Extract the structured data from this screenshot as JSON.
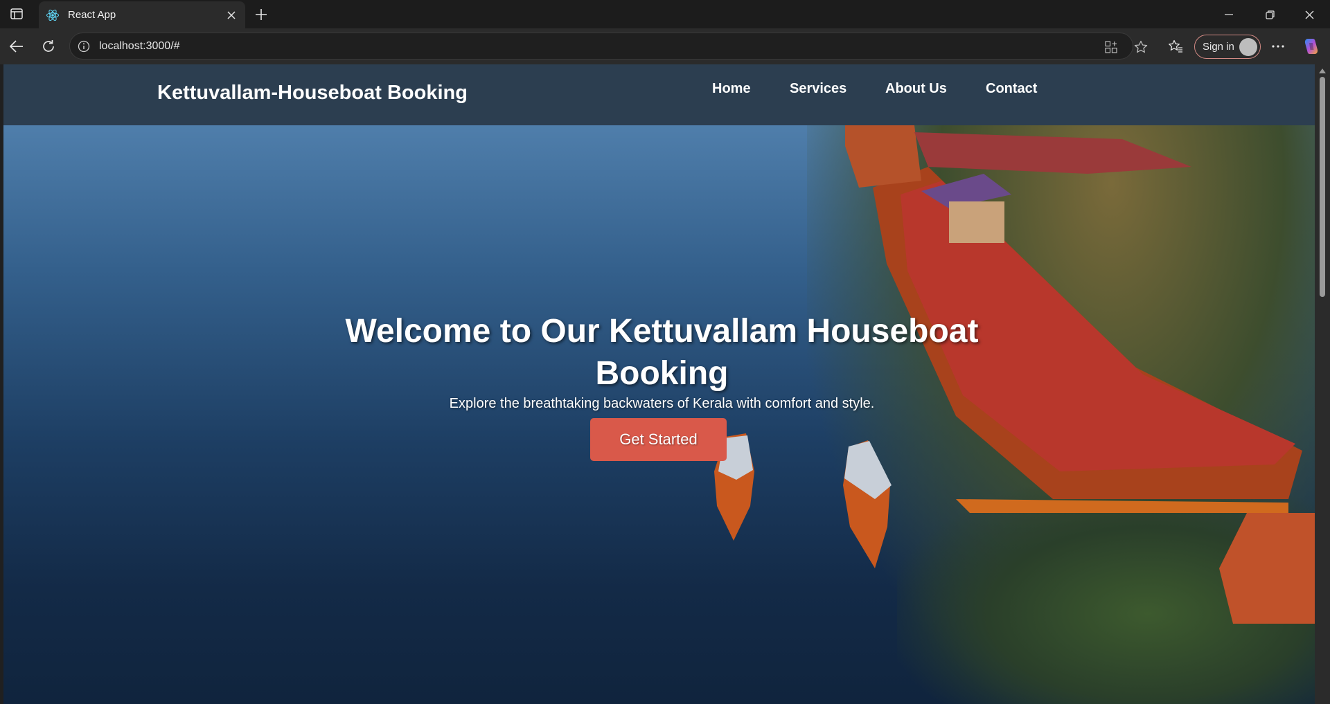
{
  "browser": {
    "tab_title": "React App",
    "url": "localhost:3000/#",
    "signin_label": "Sign in",
    "icons": [
      "sidebar-toggle-icon",
      "react-favicon-icon",
      "close-icon",
      "plus-icon",
      "minimize-icon",
      "restore-icon",
      "window-close-icon",
      "back-arrow-icon",
      "refresh-icon",
      "info-icon",
      "app-available-icon",
      "star-icon",
      "favorites-icon",
      "more-icon",
      "copilot-icon"
    ]
  },
  "site": {
    "brand": "Kettuvallam-Houseboat Booking",
    "nav": {
      "home": "Home",
      "services": "Services",
      "about": "About Us",
      "contact": "Contact"
    },
    "hero": {
      "title": "Welcome to Our Kettuvallam Houseboat Booking",
      "subtitle": "Explore the breathtaking backwaters of Kerala with comfort and style.",
      "cta": "Get Started"
    }
  },
  "colors": {
    "header_bg": "#2c3e50",
    "cta_bg": "#d9594a",
    "signin_border": "#d28a84"
  }
}
